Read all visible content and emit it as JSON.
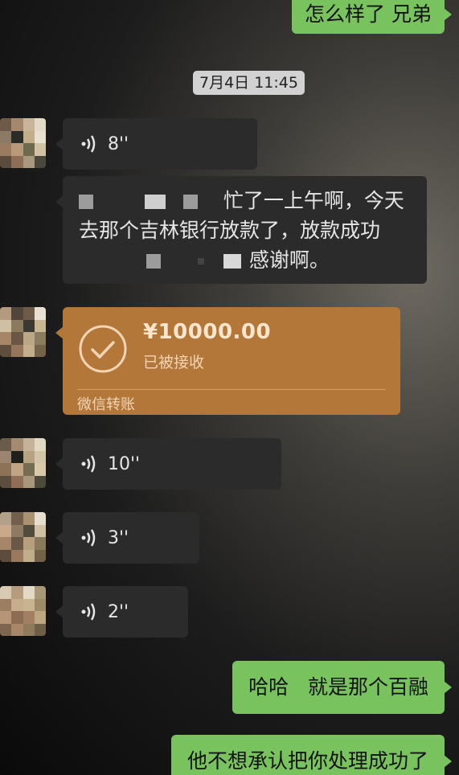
{
  "messages": {
    "out1": "怎么样了 兄弟",
    "timestamp": "7月4日 11:45",
    "voice1": "8''",
    "text_line1": "忙了一上午啊，今天",
    "text_line2": "去那个吉林银行放款了，放款成功",
    "text_line3": "感谢啊。",
    "transfer": {
      "amount": "¥10000.00",
      "status": "已被接收",
      "label": "微信转账"
    },
    "voice2": "10''",
    "voice3": "3''",
    "voice4": "2''",
    "out2": "哈哈   就是那个百融",
    "out3": "他不想承认把你处理成功了"
  },
  "colors": {
    "outgoing_bubble": "#79c35f",
    "incoming_bubble": "#2b2b2b",
    "transfer_card": "#b3773a"
  }
}
